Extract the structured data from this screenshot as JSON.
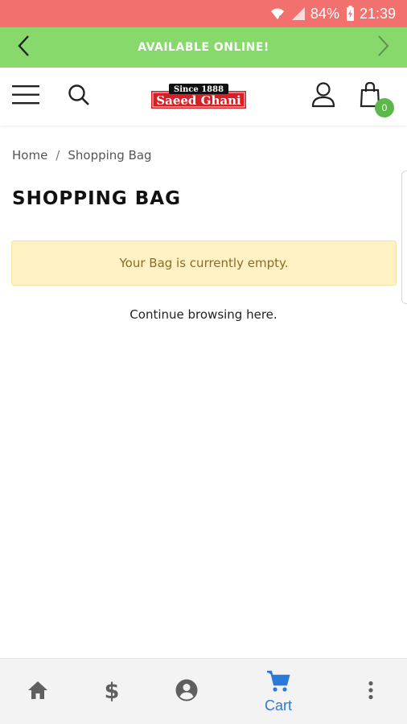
{
  "status_bar": {
    "battery": "84%",
    "time": "21:39",
    "icons": [
      "wifi-icon",
      "signal-icon",
      "battery-charging-icon"
    ]
  },
  "announcement": {
    "text": "AVAILABLE ONLINE!"
  },
  "header": {
    "logo_top": "Since 1888",
    "logo_main": "Saeed Ghani",
    "cart_count": "0",
    "icons": [
      "menu-icon",
      "search-icon",
      "user-icon",
      "shopping-bag-icon"
    ]
  },
  "breadcrumb": {
    "home": "Home",
    "separator": "/",
    "current": "Shopping Bag"
  },
  "page": {
    "title": "SHOPPING BAG",
    "empty_notice": "Your Bag is currently empty.",
    "continue_prefix": "Continue browsing ",
    "continue_link": "here",
    "continue_suffix": "."
  },
  "bottom_nav": {
    "cart_label": "Cart",
    "icons": [
      "home-icon",
      "dollar-icon",
      "account-icon",
      "cart-icon",
      "more-vertical-icon"
    ]
  },
  "colors": {
    "status_bar": "#f2706e",
    "announcement": "#86d96a",
    "badge": "#5cb84a",
    "notice_bg": "#fef1c4",
    "active_nav": "#2b7ad8",
    "logo_red": "#d81f26"
  }
}
